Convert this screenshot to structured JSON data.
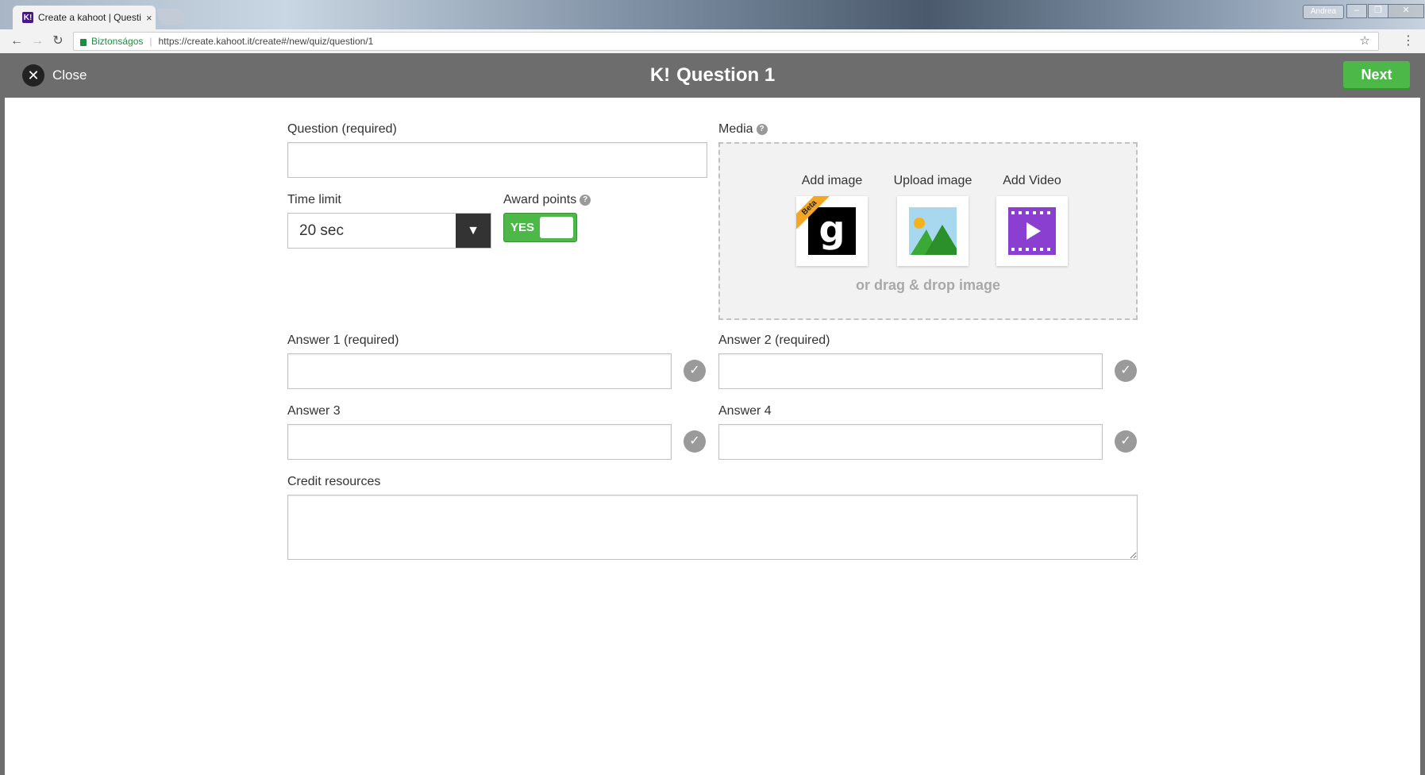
{
  "browser": {
    "tab_title": "Create a kahoot | Questio",
    "tab_favicon": "K!",
    "tab_close": "×",
    "user_name": "Andrea",
    "secure_label": "Biztonságos",
    "url": "https://create.kahoot.it/create#/new/quiz/question/1"
  },
  "header": {
    "close_label": "Close",
    "logo": "K!",
    "title": "Question 1",
    "next_label": "Next"
  },
  "form": {
    "question_label": "Question (required)",
    "question_value": "",
    "time_limit_label": "Time limit",
    "time_limit_value": "20 sec",
    "award_points_label": "Award points",
    "award_points_toggle": "YES",
    "media_label": "Media",
    "media_options": [
      {
        "label": "Add image",
        "icon": "getty-images-icon",
        "badge": "Beta"
      },
      {
        "label": "Upload image",
        "icon": "image-upload-icon"
      },
      {
        "label": "Add Video",
        "icon": "video-icon"
      }
    ],
    "drag_drop_text": "or drag & drop image",
    "answers": [
      {
        "label": "Answer 1 (required)",
        "value": ""
      },
      {
        "label": "Answer 2 (required)",
        "value": ""
      },
      {
        "label": "Answer 3",
        "value": ""
      },
      {
        "label": "Answer 4",
        "value": ""
      }
    ],
    "credit_label": "Credit resources",
    "credit_value": ""
  },
  "colors": {
    "header_bg": "#6d6d6d",
    "next_green": "#4cb847",
    "toggle_green": "#4cb847",
    "video_purple": "#8a3fd1",
    "beta_orange": "#f5a623"
  }
}
